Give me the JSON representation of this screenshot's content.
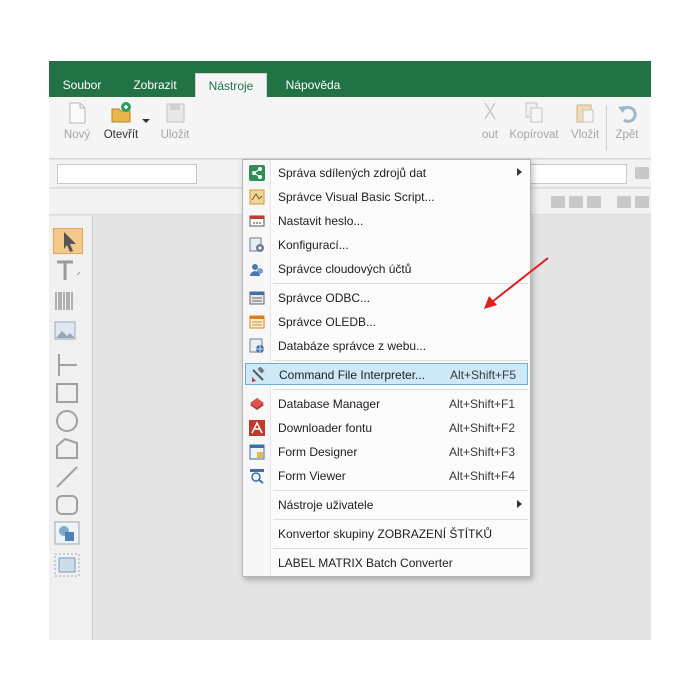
{
  "menubar": {
    "tabs": [
      "Soubor",
      "Zobrazit",
      "Nástroje",
      "Nápověda"
    ],
    "active_tab": "Nástroje",
    "color": "#217346"
  },
  "ribbon": {
    "new_label": "Nový",
    "open_label": "Otevřít",
    "save_label": "Uložit",
    "cut_label": "out",
    "copy_label": "Kopírovat",
    "paste_label": "Vložit",
    "undo_label": "Zpět"
  },
  "dropdown": {
    "items": [
      {
        "label": "Správa sdílených zdrojů dat",
        "icon": "share-icon",
        "submenu": true
      },
      {
        "label": "Správce Visual Basic Script...",
        "icon": "vbscript-icon"
      },
      {
        "label": "Nastavit heslo...",
        "icon": "password-icon"
      },
      {
        "label": "Konfigurací...",
        "icon": "configuration-icon"
      },
      {
        "label": "Správce cloudových účtů",
        "icon": "cloud-accounts-icon"
      },
      {
        "label": "Správce ODBC...",
        "icon": "odbc-icon"
      },
      {
        "label": "Správce OLEDB...",
        "icon": "oledb-icon"
      },
      {
        "label": "Databáze správce z webu...",
        "icon": "web-database-icon"
      },
      {
        "label": "Command File Interpreter...",
        "shortcut": "Alt+Shift+F5",
        "icon": "command-file-icon",
        "highlighted": true
      },
      {
        "label": "Database Manager",
        "shortcut": "Alt+Shift+F1",
        "icon": "database-manager-icon"
      },
      {
        "label": "Downloader fontu",
        "shortcut": "Alt+Shift+F2",
        "icon": "font-downloader-icon"
      },
      {
        "label": "Form Designer",
        "shortcut": "Alt+Shift+F3",
        "icon": "form-designer-icon"
      },
      {
        "label": "Form Viewer",
        "shortcut": "Alt+Shift+F4",
        "icon": "form-viewer-icon"
      },
      {
        "label": "Nástroje uživatele",
        "submenu": true
      },
      {
        "label": "Konvertor skupiny ZOBRAZENÍ ŠTÍTKŮ"
      },
      {
        "label": "LABEL  MATRIX Batch Converter"
      }
    ],
    "highlight_color": "#cde8f7"
  },
  "palette": {
    "tools": [
      "pointer-icon",
      "text-tool-icon",
      "barcode-tool-icon",
      "image-tool-icon",
      "line-tool-icon",
      "rectangle-tool-icon",
      "ellipse-tool-icon",
      "polygon-tool-icon",
      "diagonal-line-tool-icon",
      "rounded-rect-tool-icon",
      "shapes-tool-icon",
      "frame-tool-icon"
    ]
  },
  "annotation": {
    "arrow_color": "#e02020"
  }
}
